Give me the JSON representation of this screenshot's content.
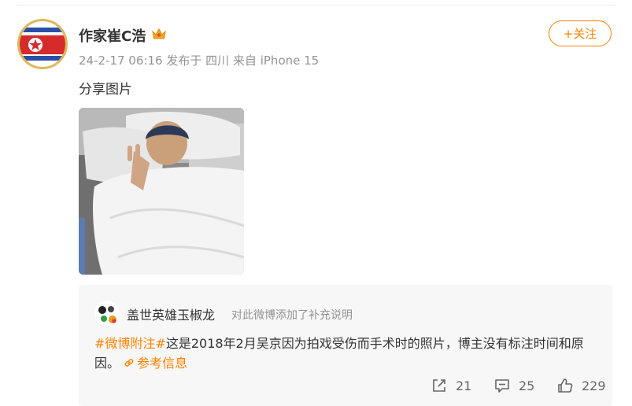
{
  "post": {
    "author": {
      "name": "作家崔C浩",
      "badge_icon": "crown-icon"
    },
    "meta": {
      "date": "24-2-17 06:16",
      "location_prefix": "发布于",
      "location": "四川",
      "source_prefix": "来自",
      "device": "iPhone 15"
    },
    "follow_label": "+关注",
    "text": "分享图片",
    "colors": {
      "accent": "#ff8200",
      "muted": "#939393",
      "note_bg": "#f7f7f7"
    }
  },
  "note": {
    "author": "盖世英雄玉椒龙",
    "description": "对此微博添加了补充说明",
    "tag": "#微博附注#",
    "content": "这是2018年2月吴京因为拍戏受伤而手术时的照片，博主没有标注时间和原因。",
    "link_label": "参考信息",
    "link_icon": "link-icon"
  },
  "actions": {
    "repost": {
      "icon": "share-icon",
      "count": "21"
    },
    "comment": {
      "icon": "comment-icon",
      "count": "25"
    },
    "like": {
      "icon": "thumbs-up-icon",
      "count": "229"
    }
  }
}
